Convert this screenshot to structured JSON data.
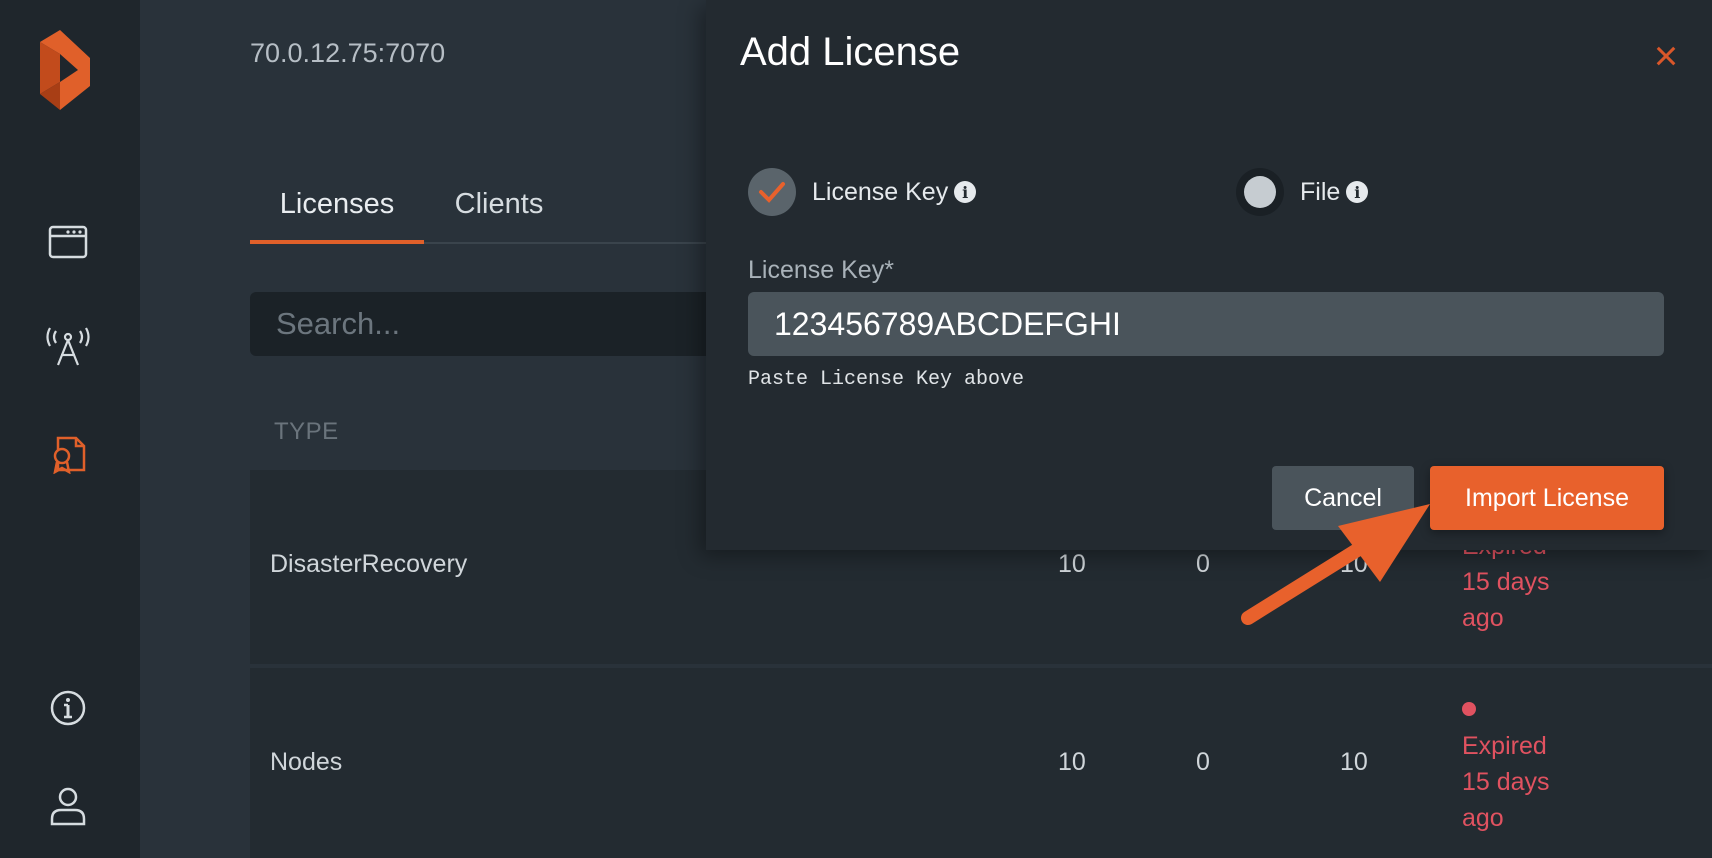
{
  "app": {
    "host": "70.0.12.75:7070"
  },
  "sidebar": {
    "items": [
      {
        "icon": "dashboard-icon"
      },
      {
        "icon": "antenna-icon"
      },
      {
        "icon": "license-icon",
        "active": true
      },
      {
        "icon": "info-icon"
      },
      {
        "icon": "user-icon"
      }
    ]
  },
  "tabs": [
    {
      "label": "Licenses",
      "active": true
    },
    {
      "label": "Clients",
      "active": false
    }
  ],
  "search": {
    "placeholder": "Search..."
  },
  "table": {
    "columns": [
      "TYPE"
    ],
    "rows": [
      {
        "type": "DisasterRecovery",
        "values": [
          "10",
          "0",
          "10"
        ],
        "status": [
          "Expired",
          "15 days",
          "ago"
        ]
      },
      {
        "type": "Nodes",
        "values": [
          "10",
          "0",
          "10"
        ],
        "status": [
          "Expired",
          "15 days",
          "ago"
        ]
      }
    ]
  },
  "modal": {
    "title": "Add License",
    "close": "×",
    "options": [
      {
        "label": "License Key",
        "selected": true
      },
      {
        "label": "File",
        "selected": false
      }
    ],
    "field_label": "License Key*",
    "field_value": "123456789ABCDEFGHI",
    "hint": "Paste License Key above",
    "cancel_label": "Cancel",
    "import_label": "Import License"
  },
  "colors": {
    "accent": "#e8612c",
    "danger": "#e05260",
    "background": "#222a31"
  }
}
